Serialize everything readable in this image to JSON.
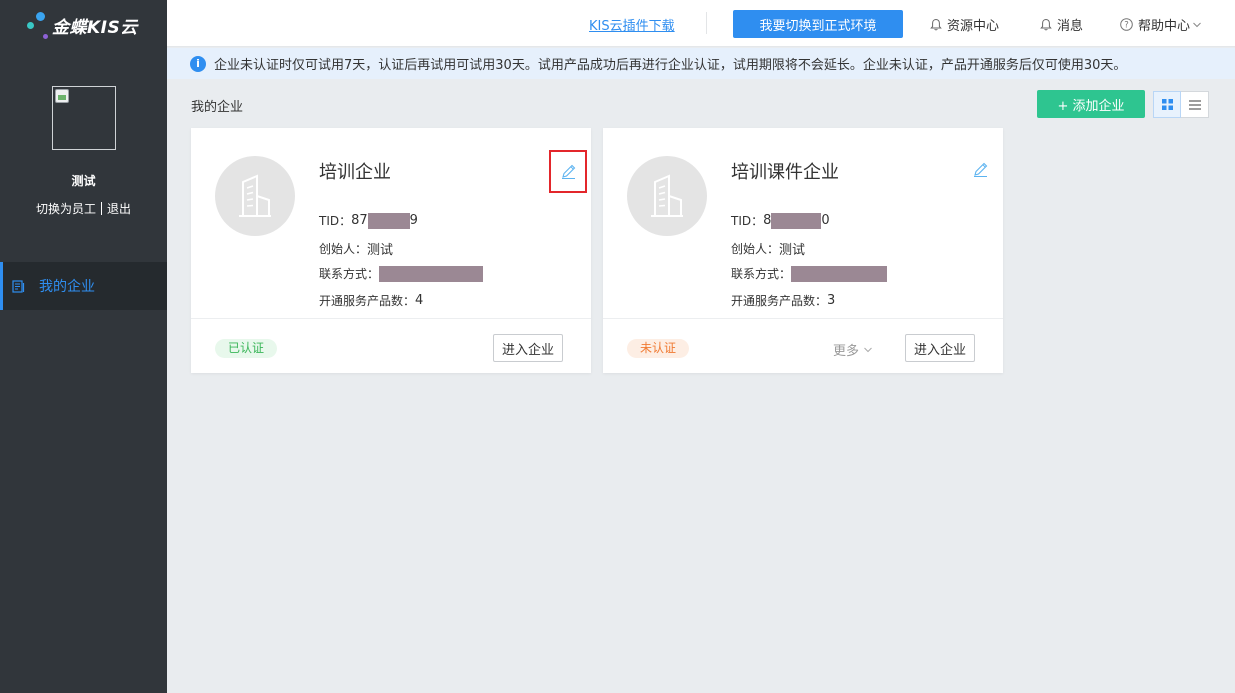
{
  "brand": {
    "name": "金蝶KIS云"
  },
  "sidebar": {
    "user_name": "测试",
    "switch_label": "切换为员工",
    "logout_label": "退出",
    "nav": [
      {
        "label": "我的企业",
        "icon": "document-icon",
        "active": true
      }
    ]
  },
  "topbar": {
    "plugin_link": "KIS云插件下载",
    "switch_env_button": "我要切换到正式环境",
    "resource_center": "资源中心",
    "messages": "消息",
    "help_center": "帮助中心"
  },
  "notice": {
    "text": "企业未认证时仅可试用7天，认证后再试用可试用30天。试用产品成功后再进行企业认证，试用期限将不会延长。企业未认证，产品开通服务后仅可使用30天。"
  },
  "main": {
    "section_title": "我的企业",
    "add_button": "+ 添加企业",
    "view_modes": [
      "grid",
      "list"
    ],
    "active_view": "grid"
  },
  "companies": [
    {
      "name": "培训企业",
      "tid_label": "TID：",
      "tid_prefix": "87",
      "tid_suffix": "9",
      "founder_label": "创始人：",
      "founder": "测试",
      "contact_label": "联系方式：",
      "products_label": "开通服务产品数：",
      "products_count": "4",
      "status": "已认证",
      "enter_button": "进入企业"
    },
    {
      "name": "培训课件企业",
      "tid_label": "TID：",
      "tid_prefix": "8",
      "tid_suffix": "0",
      "founder_label": "创始人：",
      "founder": "测试",
      "contact_label": "联系方式：",
      "products_label": "开通服务产品数：",
      "products_count": "3",
      "status": "未认证",
      "more_label": "更多",
      "enter_button": "进入企业"
    }
  ],
  "colors": {
    "primary": "#2f8ef0",
    "success": "#2ec590",
    "sidebar_bg": "#31363b",
    "highlight_border": "#e3262b"
  }
}
